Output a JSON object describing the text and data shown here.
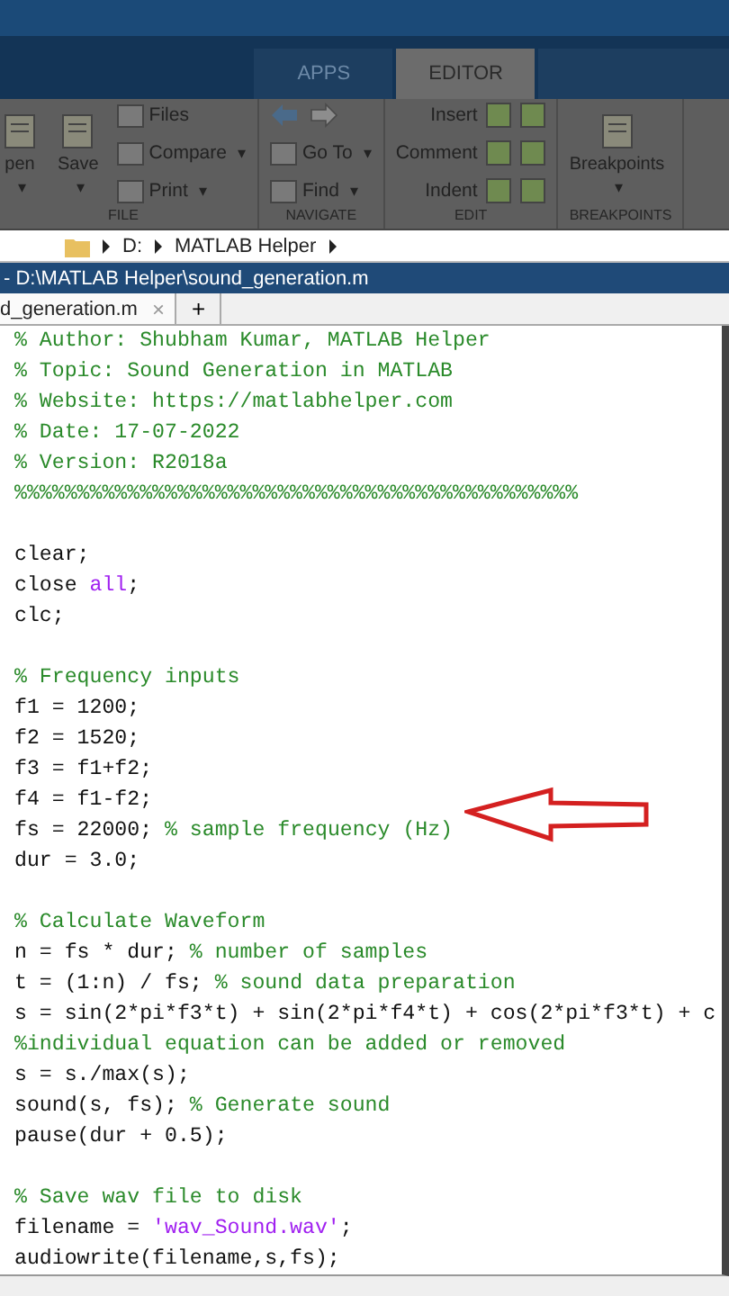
{
  "ribbon": {
    "tabs": [
      {
        "label": "APPS",
        "selected": false
      },
      {
        "label": "EDITOR",
        "selected": true
      },
      {
        "selected": false
      }
    ],
    "sections": [
      {
        "label": "FILE",
        "items": [
          {
            "kind": "large",
            "label": "pen",
            "caret": "▾"
          },
          {
            "kind": "large",
            "label": "Save",
            "caret": "▾"
          },
          {
            "kind": "stack",
            "rows": [
              {
                "kind": "button",
                "label": "Files"
              },
              {
                "kind": "button",
                "label": "Compare",
                "caret": "▾"
              },
              {
                "kind": "button",
                "label": "Print",
                "caret": "▾"
              }
            ]
          }
        ]
      },
      {
        "label": "NAVIGATE",
        "items": [
          {
            "kind": "stack",
            "rows": [
              {
                "kind": "arrows"
              },
              {
                "kind": "button",
                "label": "Go To",
                "caret": "▾"
              },
              {
                "kind": "button",
                "label": "Find",
                "caret": "▾"
              }
            ]
          }
        ]
      },
      {
        "label": "EDIT",
        "items": [
          {
            "kind": "edit",
            "rows": [
              {
                "label": "Insert"
              },
              {
                "label": "Comment"
              },
              {
                "label": "Indent"
              }
            ]
          }
        ]
      },
      {
        "label": "BREAKPOINTS",
        "items": [
          {
            "kind": "large",
            "label": "Breakpoints",
            "caret": "▾"
          }
        ]
      }
    ]
  },
  "address": {
    "parts": [
      "D:",
      "MATLAB Helper"
    ]
  },
  "editor": {
    "title": "- D:\\MATLAB Helper\\sound_generation.m",
    "tab": {
      "label": "d_generation.m",
      "close": "×"
    },
    "add_tab": "+",
    "lines": [
      {
        "segments": [
          {
            "kind": "comment",
            "text": "% Author: Shubham Kumar, MATLAB Helper"
          }
        ]
      },
      {
        "segments": [
          {
            "kind": "comment",
            "text": "% Topic: Sound Generation in MATLAB"
          }
        ]
      },
      {
        "segments": [
          {
            "kind": "comment",
            "text": "% Website: https://matlabhelper.com"
          }
        ]
      },
      {
        "segments": [
          {
            "kind": "comment",
            "text": "% Date: 17-07-2022"
          }
        ]
      },
      {
        "segments": [
          {
            "kind": "comment",
            "text": "% Version: R2018a"
          }
        ]
      },
      {
        "segments": [
          {
            "kind": "comment",
            "text": "%%%%%%%%%%%%%%%%%%%%%%%%%%%%%%%%%%%%%%%%%%%%%"
          }
        ]
      },
      {
        "kind": "blank"
      },
      {
        "segments": [
          {
            "kind": "code",
            "text": "clear;"
          }
        ]
      },
      {
        "segments": [
          {
            "kind": "code",
            "text": "close "
          },
          {
            "kind": "string",
            "text": "all"
          },
          {
            "kind": "code",
            "text": ";"
          }
        ]
      },
      {
        "segments": [
          {
            "kind": "code",
            "text": "clc;"
          }
        ]
      },
      {
        "kind": "blank"
      },
      {
        "segments": [
          {
            "kind": "comment",
            "text": "% Frequency inputs"
          }
        ]
      },
      {
        "segments": [
          {
            "kind": "code",
            "text": "f1 = 1200;"
          }
        ]
      },
      {
        "segments": [
          {
            "kind": "code",
            "text": "f2 = 1520;"
          }
        ]
      },
      {
        "segments": [
          {
            "kind": "code",
            "text": "f3 = f1+f2;"
          }
        ]
      },
      {
        "segments": [
          {
            "kind": "code",
            "text": "f4 = f1-f2;"
          }
        ]
      },
      {
        "segments": [
          {
            "kind": "code",
            "text": "fs = 22000; "
          },
          {
            "kind": "comment",
            "text": "% sample frequency (Hz)"
          }
        ]
      },
      {
        "segments": [
          {
            "kind": "code",
            "text": "dur = 3.0;"
          }
        ]
      },
      {
        "kind": "blank"
      },
      {
        "segments": [
          {
            "kind": "comment",
            "text": "% Calculate Waveform"
          }
        ]
      },
      {
        "segments": [
          {
            "kind": "code",
            "text": "n = fs * dur; "
          },
          {
            "kind": "comment",
            "text": "% number of samples"
          }
        ]
      },
      {
        "segments": [
          {
            "kind": "code",
            "text": "t = (1:n) / fs; "
          },
          {
            "kind": "comment",
            "text": "% sound data preparation"
          }
        ]
      },
      {
        "segments": [
          {
            "kind": "code",
            "text": "s = sin(2*pi*f3*t) + sin(2*pi*f4*t) + cos(2*pi*f3*t) + c"
          }
        ]
      },
      {
        "segments": [
          {
            "kind": "comment",
            "text": "%individual equation can be added or removed"
          }
        ]
      },
      {
        "segments": [
          {
            "kind": "code",
            "text": "s = s./max(s);"
          }
        ]
      },
      {
        "segments": [
          {
            "kind": "code",
            "text": "sound(s, fs); "
          },
          {
            "kind": "comment",
            "text": "% Generate sound"
          }
        ]
      },
      {
        "segments": [
          {
            "kind": "code",
            "text": "pause(dur + 0.5);"
          }
        ]
      },
      {
        "kind": "blank"
      },
      {
        "segments": [
          {
            "kind": "comment",
            "text": "% Save wav file to disk"
          }
        ]
      },
      {
        "segments": [
          {
            "kind": "code",
            "text": "filename = "
          },
          {
            "kind": "string",
            "text": "'wav_Sound.wav'"
          },
          {
            "kind": "code",
            "text": ";"
          }
        ]
      },
      {
        "segments": [
          {
            "kind": "code",
            "text": "audiowrite(filename,s,fs);"
          }
        ]
      }
    ]
  }
}
